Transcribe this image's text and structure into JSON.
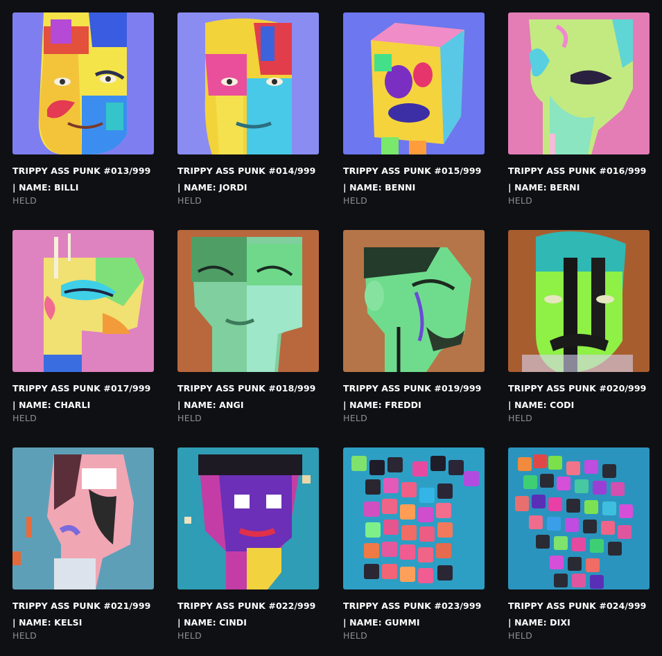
{
  "gallery": {
    "items": [
      {
        "title": "TRIPPY ASS PUNK #013/999",
        "name_line": "| NAME: BILLI",
        "status": "HELD",
        "bg": "#7f7ef0",
        "accent": "#f7e53b"
      },
      {
        "title": "TRIPPY ASS PUNK #014/999",
        "name_line": "| NAME: JORDI",
        "status": "HELD",
        "bg": "#8a8cf2",
        "accent": "#f4d93a"
      },
      {
        "title": "TRIPPY ASS PUNK #015/999",
        "name_line": "| NAME: BENNI",
        "status": "HELD",
        "bg": "#6d77ef",
        "accent": "#e8f046"
      },
      {
        "title": "TRIPPY ASS PUNK #016/999",
        "name_line": "| NAME: BERNI",
        "status": "HELD",
        "bg": "#e47cb6",
        "accent": "#c9f07a"
      },
      {
        "title": "TRIPPY ASS PUNK #017/999",
        "name_line": "| NAME: CHARLI",
        "status": "HELD",
        "bg": "#df82c0",
        "accent": "#f5d86a"
      },
      {
        "title": "TRIPPY ASS PUNK #018/999",
        "name_line": "| NAME: ANGI",
        "status": "HELD",
        "bg": "#b9683e",
        "accent": "#7fd7a3"
      },
      {
        "title": "TRIPPY ASS PUNK #019/999",
        "name_line": "| NAME: FREDDI",
        "status": "HELD",
        "bg": "#b57548",
        "accent": "#6fe08d"
      },
      {
        "title": "TRIPPY ASS PUNK #020/999",
        "name_line": "| NAME: CODI",
        "status": "HELD",
        "bg": "#a85d2f",
        "accent": "#8ff542"
      },
      {
        "title": "TRIPPY ASS PUNK #021/999",
        "name_line": "| NAME: KELSI",
        "status": "HELD",
        "bg": "#5e9fb8",
        "accent": "#f2a6b4"
      },
      {
        "title": "TRIPPY ASS PUNK #022/999",
        "name_line": "| NAME: CINDI",
        "status": "HELD",
        "bg": "#2f9db6",
        "accent": "#c43da6"
      },
      {
        "title": "TRIPPY ASS PUNK #023/999",
        "name_line": "| NAME: GUMMI",
        "status": "HELD",
        "bg": "#2d9fc5",
        "accent": "#f06487"
      },
      {
        "title": "TRIPPY ASS PUNK #024/999",
        "name_line": "| NAME: DIXI",
        "status": "HELD",
        "bg": "#2b94be",
        "accent": "#d64fd8"
      }
    ]
  }
}
